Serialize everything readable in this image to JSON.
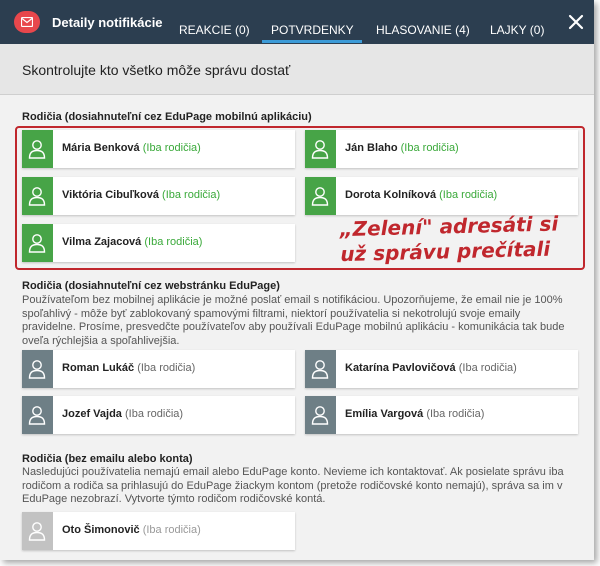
{
  "header": {
    "title": "Detaily notifikácie",
    "tabs": [
      {
        "label": "REAKCIE (0)",
        "active": false
      },
      {
        "label": "POTVRDENKY",
        "active": true
      },
      {
        "label": "HLASOVANIE (4)",
        "active": false
      },
      {
        "label": "LAJKY (0)",
        "active": false
      }
    ],
    "close_icon": "close-icon",
    "logo_icon": "envelope-icon"
  },
  "subheader": {
    "title": "Skontrolujte kto všetko môže správu dostať"
  },
  "sections": [
    {
      "title": "Rodičia (dosiahnuteľní cez EduPage mobilnú aplikáciu)",
      "status": "green",
      "recipients": [
        {
          "name": "Mária Benková",
          "role": "(Iba rodičia)"
        },
        {
          "name": "Ján Blaho",
          "role": "(Iba rodičia)"
        },
        {
          "name": "Viktória Cibuľková",
          "role": "(Iba rodičia)"
        },
        {
          "name": "Dorota Kolníková",
          "role": "(Iba rodičia)"
        },
        {
          "name": "Vilma Zajacová",
          "role": "(Iba rodičia)"
        }
      ]
    },
    {
      "title": "Rodičia (dosiahnuteľní cez webstránku EduPage)",
      "description": "Používateľom bez mobilnej aplikácie je možné poslať email s notifikáciou. Upozorňujeme, že email nie je 100% spoľahlivý - môže byť zablokovaný spamovými filtrami, niektorí používatelia si nekotrolujú svoje emaily pravidelne. Prosíme, presvedčte používateľov aby používali EduPage mobilnú aplikáciu - komunikácia tak bude oveľa rýchlejšia a spoľahlivejšia.",
      "status": "gray",
      "recipients": [
        {
          "name": "Roman Lukáč",
          "role": "(Iba rodičia)"
        },
        {
          "name": "Katarína Pavlovičová",
          "role": "(Iba rodičia)"
        },
        {
          "name": "Jozef Vajda",
          "role": "(Iba rodičia)"
        },
        {
          "name": "Emília Vargová",
          "role": "(Iba rodičia)"
        }
      ]
    },
    {
      "title": "Rodičia (bez emailu alebo konta)",
      "description": "Nasledujúci používatelia nemajú email alebo EduPage konto. Nevieme ich kontaktovať. Ak posielate správu iba rodičom a rodiča sa prihlasujú do EduPage žiackym kontom (pretože rodičovské konto nemajú), správa sa im v EduPage nezobrazí. Vytvorte týmto rodičom rodičovské kontá.",
      "status": "light-gray",
      "recipients": [
        {
          "name": "Oto Šimonovič",
          "role": "(Iba rodičia)"
        }
      ]
    }
  ],
  "annotation": {
    "line1": "„Zelení\" adresáti si",
    "line2": "už správu prečítali",
    "color": "#c0272d"
  },
  "colors": {
    "topbar": "#2c3e50",
    "tab_underline": "#3c9bd8",
    "green": "#47a447",
    "gray": "#6e7f86",
    "light_gray": "#c2c2c2",
    "logo": "#e8474c"
  }
}
